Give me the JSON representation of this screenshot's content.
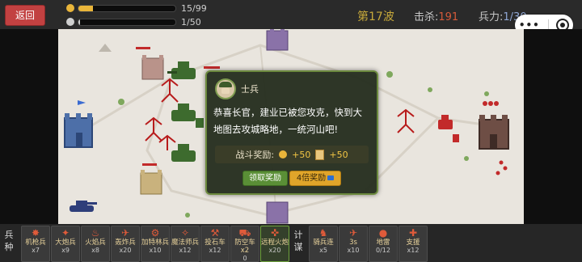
{
  "header": {
    "back_label": "返回",
    "gold": {
      "text": "15/99",
      "fraction": 0.15,
      "color": "#e9b53a"
    },
    "pop": {
      "text": "1/50",
      "fraction": 0.02,
      "color": "#cfcfcf"
    },
    "wave_label": "第17波",
    "kills_label": "击杀:",
    "kills_value": "191",
    "troops_label": "兵力:",
    "troops_value": "1/30"
  },
  "dialog": {
    "speaker": "士兵",
    "message": "恭喜长官，建业已被您攻克，快到大地图去攻城略地，一统河山吧!",
    "reward_label": "战斗奖励:",
    "coin_reward": "+50",
    "scroll_reward": "+50",
    "claim_label": "领取奖励",
    "quad_label": "4倍奖励"
  },
  "footer": {
    "category_troops": "兵种",
    "category_strategy": "计谋",
    "units": [
      {
        "name": "机枪兵",
        "count": "x7",
        "icon": "machine-gunner-icon"
      },
      {
        "name": "大炮兵",
        "count": "x9",
        "icon": "cannon-icon"
      },
      {
        "name": "火焰兵",
        "count": "x8",
        "icon": "flamethrower-icon"
      },
      {
        "name": "轰炸兵",
        "count": "x20",
        "icon": "bomber-icon"
      },
      {
        "name": "加特林兵",
        "count": "x10",
        "icon": "gatling-icon"
      },
      {
        "name": "魔法师兵",
        "count": "x12",
        "icon": "mage-icon"
      },
      {
        "name": "投石车",
        "count": "x12",
        "icon": "catapult-icon"
      },
      {
        "name": "防空车x2",
        "count": "0",
        "icon": "aa-vehicle-icon"
      },
      {
        "name": "远程火炮",
        "count": "x20",
        "icon": "artillery-icon"
      }
    ],
    "strategies": [
      {
        "name": "骑兵连",
        "count": "x5",
        "icon": "cavalry-icon"
      },
      {
        "name": "3s",
        "count": "x10",
        "icon": "airstrike-icon"
      },
      {
        "name": "地雷",
        "count": "0/12",
        "icon": "landmine-icon"
      },
      {
        "name": "支援",
        "count": "x12",
        "icon": "support-icon"
      }
    ]
  }
}
